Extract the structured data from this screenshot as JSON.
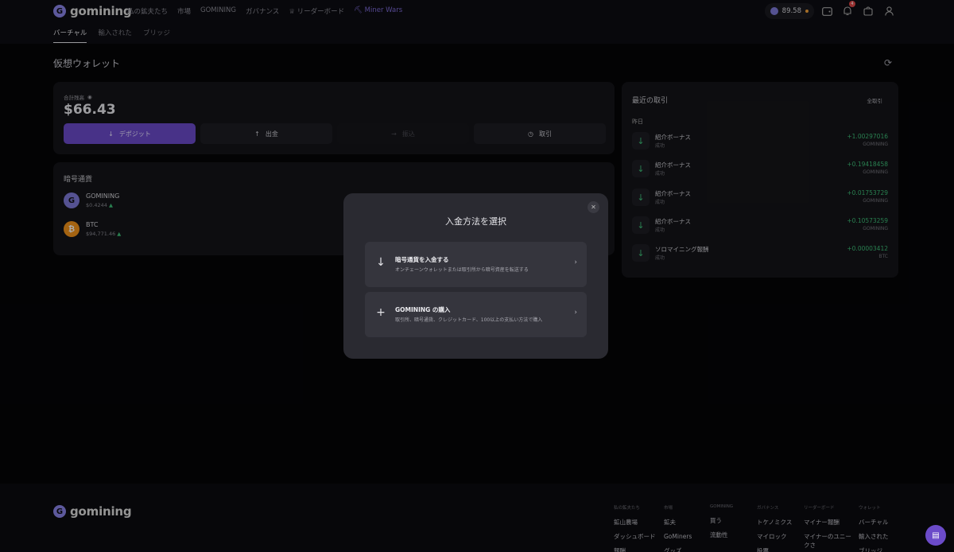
{
  "brand": {
    "name": "gomining"
  },
  "nav": {
    "items": [
      "私の鉱夫たち",
      "市場",
      "GOMINING",
      "ガバナンス",
      "リーダーボード",
      "Miner Wars"
    ]
  },
  "subnav": {
    "items": [
      "バーチャル",
      "輸入された",
      "ブリッジ"
    ]
  },
  "header": {
    "balance": "89.58",
    "notifications_count": "4"
  },
  "page": {
    "title": "仮想ウォレット"
  },
  "wallet": {
    "total_label": "合計残高",
    "total_value": "$66.43",
    "actions": [
      "デポジット",
      "出金",
      "振込",
      "取引"
    ]
  },
  "crypto": {
    "title": "暗号通貨",
    "assets": [
      {
        "name": "GOMINING",
        "price": "$0.4244"
      },
      {
        "name": "BTC",
        "price": "$94,771.46"
      }
    ]
  },
  "transactions": {
    "title": "最近の取引",
    "all_label": "全取引",
    "day_label": "昨日",
    "rows": [
      {
        "name": "紹介ボーナス",
        "status": "成功",
        "amount": "+1.00297016",
        "currency": "GOMINING"
      },
      {
        "name": "紹介ボーナス",
        "status": "成功",
        "amount": "+0.19418458",
        "currency": "GOMINING"
      },
      {
        "name": "紹介ボーナス",
        "status": "成功",
        "amount": "+0.01753729",
        "currency": "GOMINING"
      },
      {
        "name": "紹介ボーナス",
        "status": "成功",
        "amount": "+0.10573259",
        "currency": "GOMINING"
      },
      {
        "name": "ソロマイニング報酬",
        "status": "成功",
        "amount": "+0.00003412",
        "currency": "BTC"
      }
    ]
  },
  "modal": {
    "title": "入金方法を選択",
    "options": [
      {
        "title": "暗号通貨を入金する",
        "subtitle": "オンチェーンウォレットまたは取引所から暗号資産を転送する",
        "icon": "arrow-down-icon"
      },
      {
        "title": "GOMINING の購入",
        "subtitle": "取引所、暗号通貨、クレジットカード、100以上の支払い方法で購入",
        "icon": "plus-icon"
      }
    ]
  },
  "footer": {
    "columns": [
      {
        "head": "私の鉱夫たち",
        "items": [
          "鉱山農場",
          "ダッシュボード",
          "報酬"
        ]
      },
      {
        "head": "市場",
        "items": [
          "鉱夫",
          "GoMiners",
          "グッズ"
        ]
      },
      {
        "head": "GOMINING",
        "items": [
          "買う",
          "流動性"
        ]
      },
      {
        "head": "ガバナンス",
        "items": [
          "トケノミクス",
          "マイロック",
          "投票"
        ]
      },
      {
        "head": "リーダーボード",
        "items": [
          "マイナー報酬",
          "マイナーのユニー",
          "クさ"
        ]
      },
      {
        "head": "ウォレット",
        "items": [
          "バーチャル",
          "輸入された",
          "ブリッジ"
        ]
      }
    ]
  },
  "colors": {
    "accent": "#6b4bc9",
    "positive": "#3dbd77",
    "badge": "#e04848"
  }
}
